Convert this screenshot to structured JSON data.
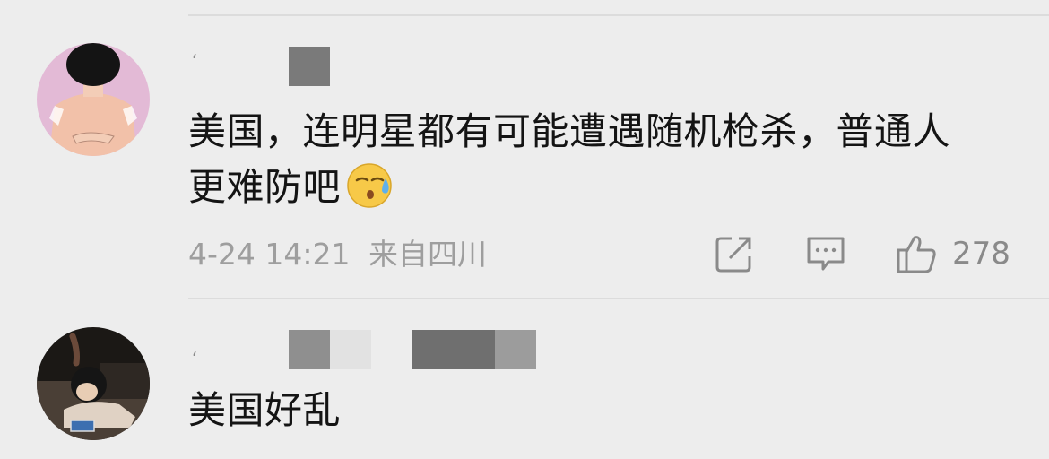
{
  "comments": [
    {
      "text_line1": "美国，连明星都有可能遭遇随机枪杀，普通人",
      "text_line2": "更难防吧",
      "emoji": "sweat-emoji",
      "time": "4-24 14:21",
      "location": "来自四川",
      "like_count": "278",
      "username_visible": false
    },
    {
      "text": "美国好乱",
      "username_visible": false
    }
  ],
  "icons": {
    "share": "share-icon",
    "reply": "comment-icon",
    "like": "thumbs-up-icon"
  },
  "colors": {
    "background": "#ededed",
    "text": "#141414",
    "meta": "#9e9e9e",
    "icon": "#8a8a8a",
    "divider": "#dcdcdc"
  }
}
